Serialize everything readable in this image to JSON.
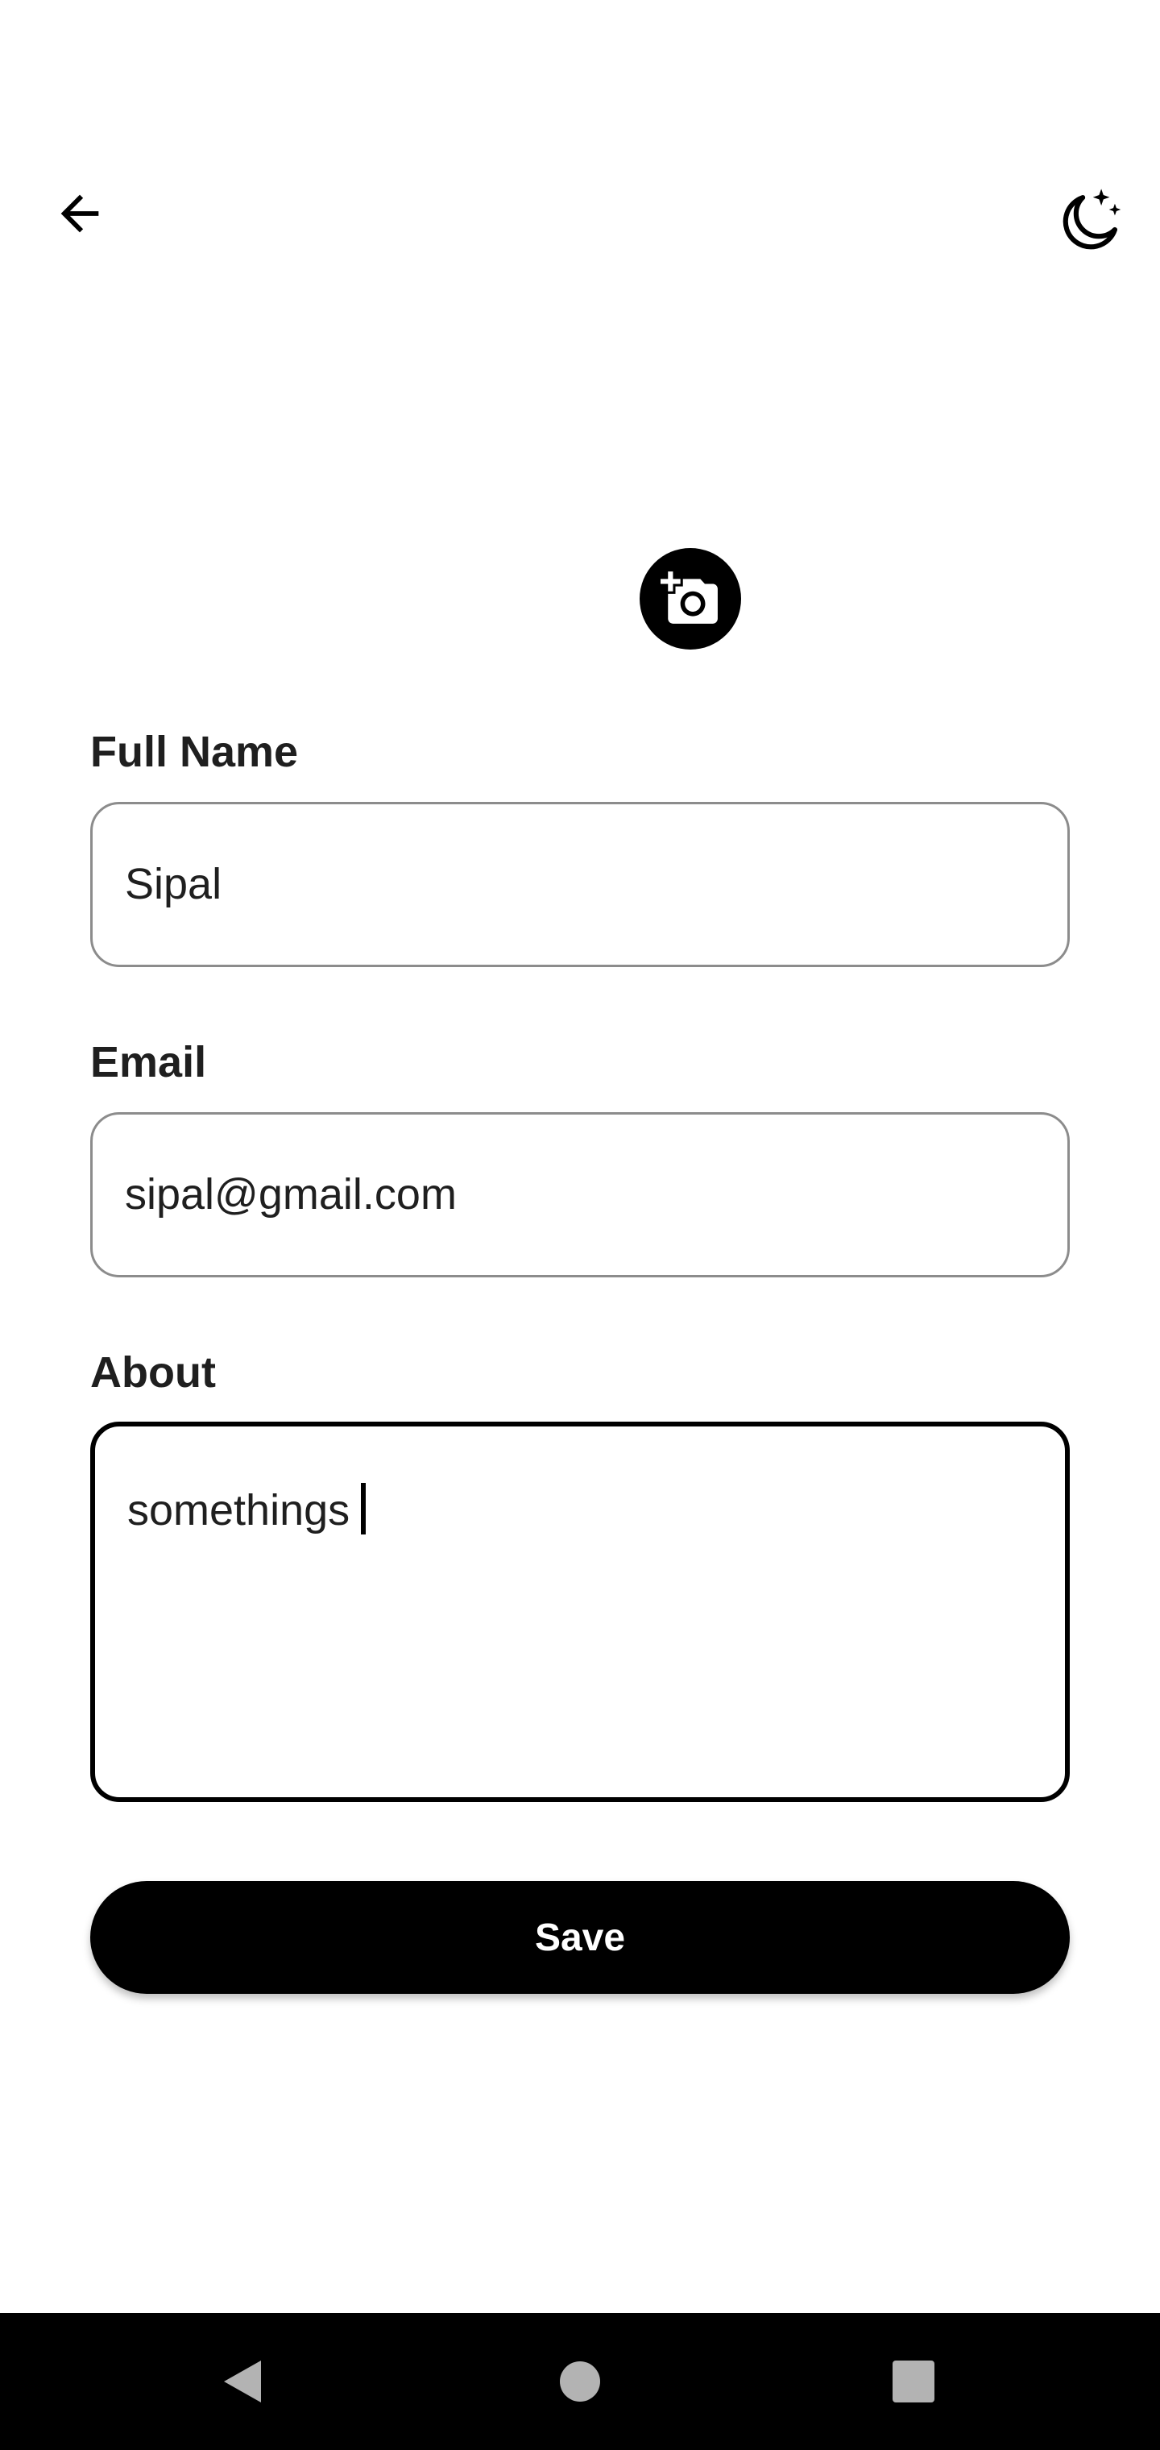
{
  "header": {
    "back_icon": "arrow-left-icon",
    "theme_icon": "moon-stars-icon"
  },
  "profile": {
    "add_photo_icon": "add-a-photo-icon"
  },
  "form": {
    "full_name": {
      "label": "Full Name",
      "value": "Sipal"
    },
    "email": {
      "label": "Email",
      "value": "sipal@gmail.com"
    },
    "about": {
      "label": "About",
      "value": "somethings"
    },
    "save_label": "Save"
  },
  "system_nav": {
    "back_icon": "nav-back-icon",
    "home_icon": "nav-home-icon",
    "recents_icon": "nav-recents-icon"
  },
  "colors": {
    "background": "#ffffff",
    "primary": "#000000",
    "field_border": "#8c8c8c",
    "text": "#1f1f1f",
    "nav_icon": "#b3b3b3"
  }
}
